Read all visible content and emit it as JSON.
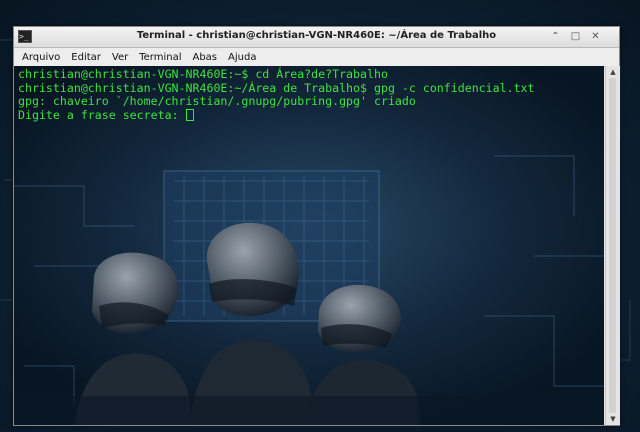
{
  "window": {
    "title": "Terminal - christian@christian-VGN-NR460E: ~/Área de Trabalho",
    "app_icon": "terminal-icon",
    "controls": [
      "minimize-icon",
      "maximize-icon",
      "close-icon"
    ]
  },
  "menu": {
    "items": [
      {
        "label": "Arquivo"
      },
      {
        "label": "Editar"
      },
      {
        "label": "Ver"
      },
      {
        "label": "Terminal"
      },
      {
        "label": "Abas"
      },
      {
        "label": "Ajuda"
      }
    ]
  },
  "terminal": {
    "lines": [
      "christian@christian-VGN-NR460E:~$ cd Área?de?Trabalho",
      "christian@christian-VGN-NR460E:~/Área de Trabalho$ gpg -c confidencial.txt",
      "gpg: chaveiro `/home/christian/.gnupg/pubring.gpg' criado",
      "Digite a frase secreta: "
    ],
    "text_color": "#3fe23f"
  },
  "colors": {
    "terminal_text": "#3fe23f",
    "desktop_bg": "#0b1a2c"
  }
}
